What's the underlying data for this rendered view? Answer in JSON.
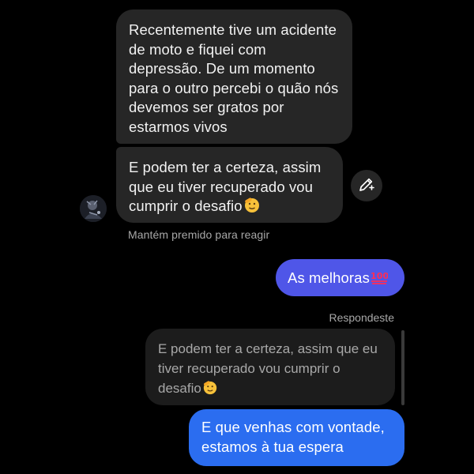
{
  "thread": {
    "incoming_1": "Recentemente tive um acidente de moto e fiquei com depressão. De um momento para o outro percebi o quão nós devemos ser gratos por estarmos vivos",
    "incoming_2": "E podem ter a certeza, assim que eu tiver recuperado vou cumprir o desafio",
    "hint": "Mantém premido para reagir",
    "outgoing_1": "As melhoras",
    "replied_label": "Respondeste",
    "quoted_text": "E podem ter a certeza, assim que eu tiver recuperado vou cumprir o desafio",
    "outgoing_2": "E que venhas com vontade, estamos à tua espera"
  },
  "icons": {
    "edit": "pencil-sparkle-icon",
    "avatar": "user-avatar",
    "emoji_salute": "saluting-face-emoji",
    "emoji_hearts": "100-emoji"
  },
  "colors": {
    "background": "#000000",
    "incoming_bubble": "#262626",
    "outgoing_purple": "#4f56e8",
    "outgoing_blue": "#2b6df0",
    "secondary_text": "#a8a8a8"
  }
}
